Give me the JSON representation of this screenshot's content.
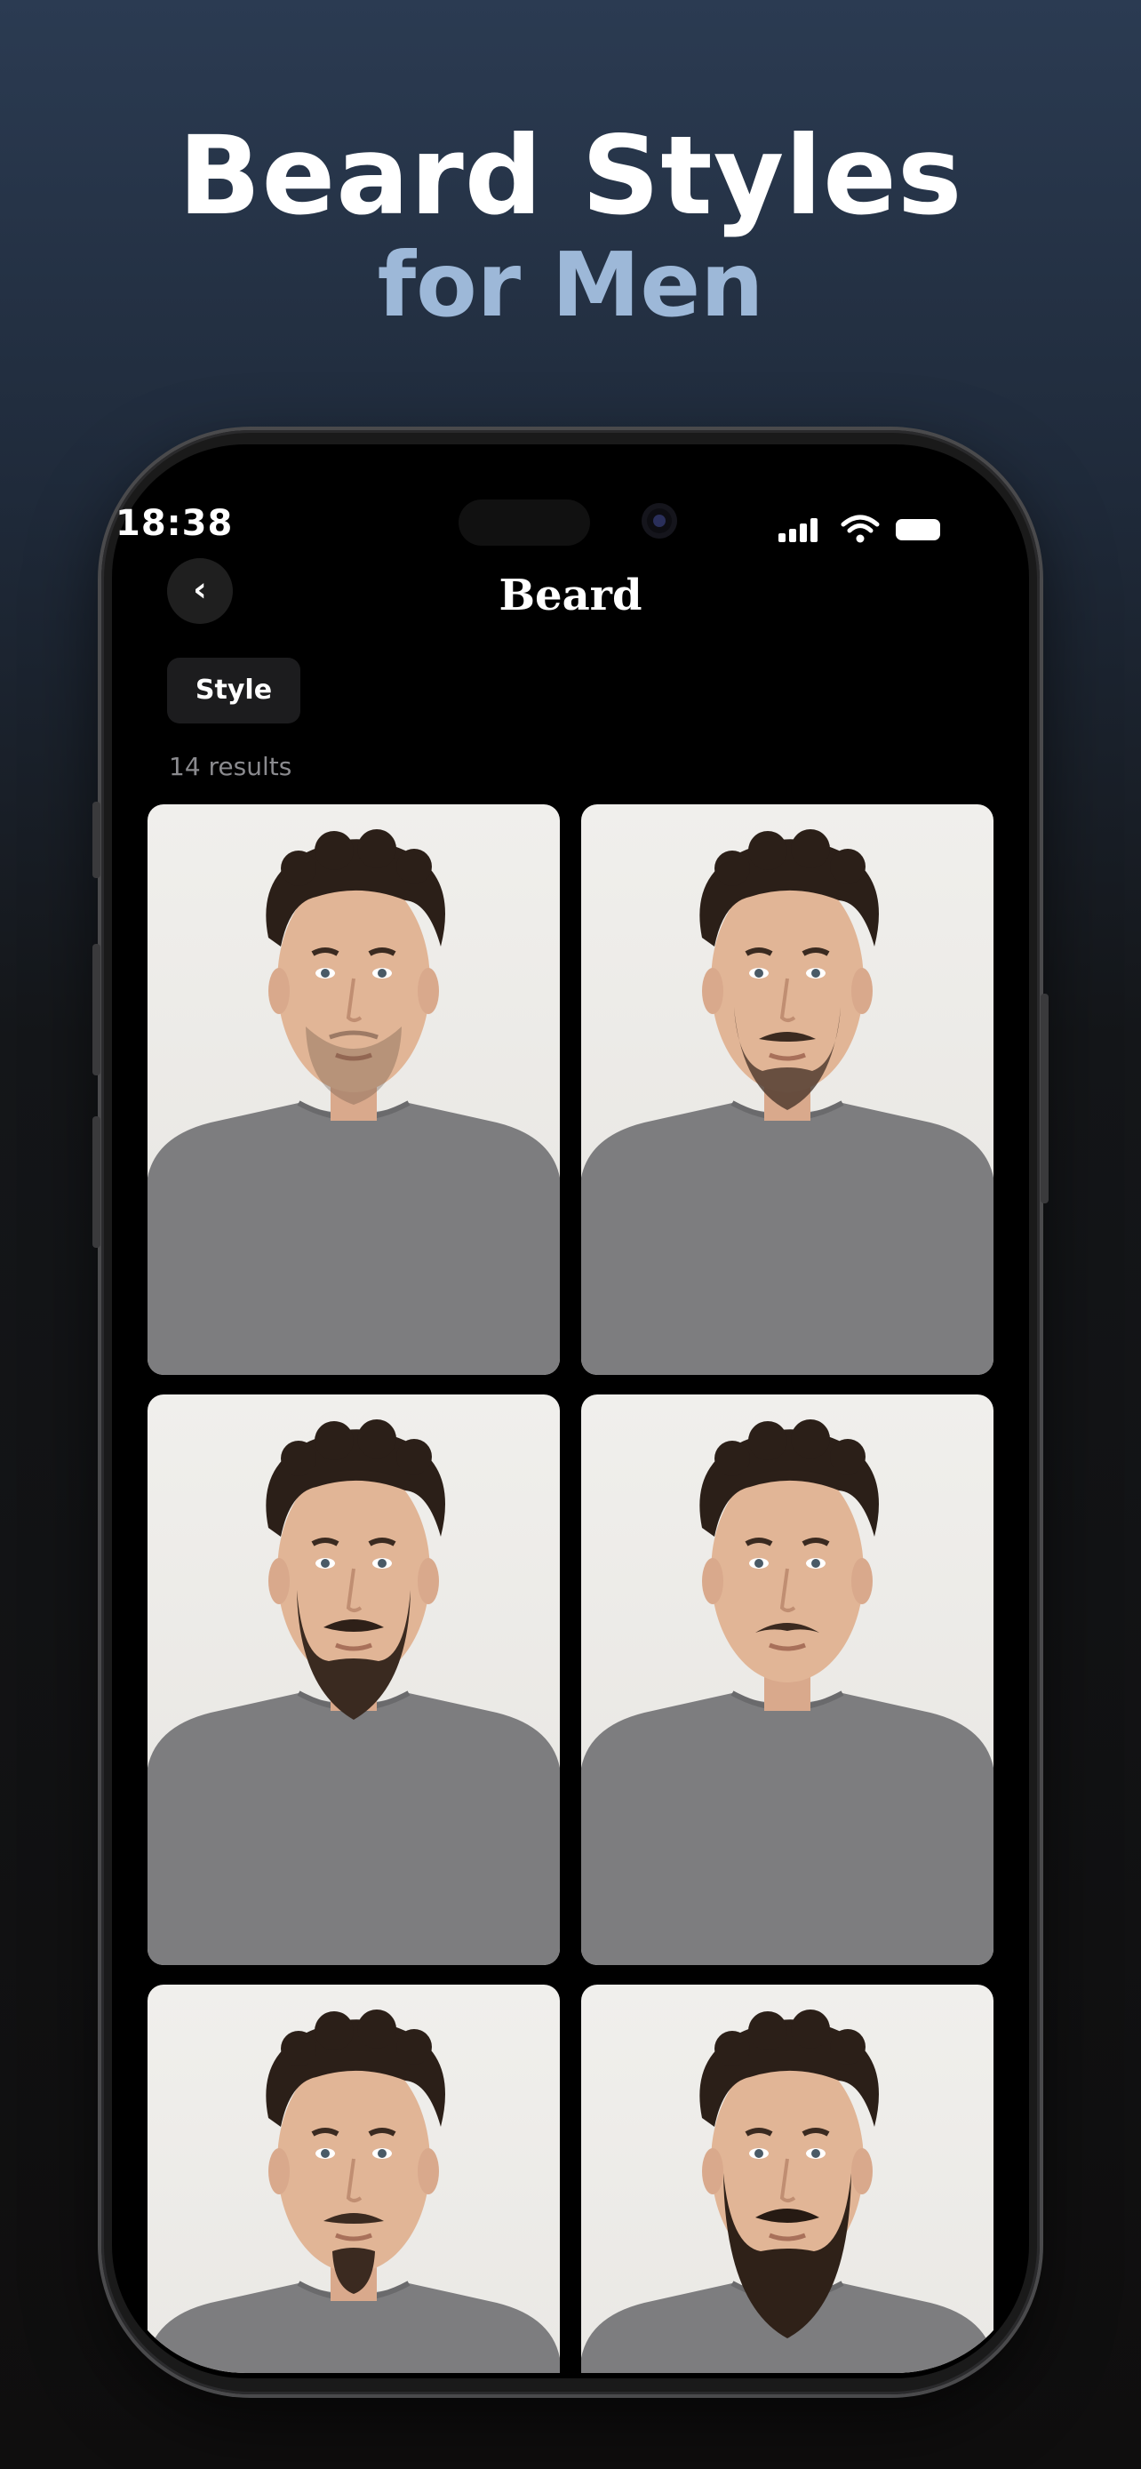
{
  "promo": {
    "title_line1": "Beard Styles",
    "title_line2": "for Men"
  },
  "status_bar": {
    "time": "18:38"
  },
  "header": {
    "back_icon": "chevron-left-icon",
    "back_glyph": "‹",
    "title": "Beard"
  },
  "filter": {
    "chip_label": "Style"
  },
  "results": {
    "count_text": "14 results"
  },
  "styles": [
    {
      "beard": "light-stubble"
    },
    {
      "beard": "short-boxed"
    },
    {
      "beard": "full-beard"
    },
    {
      "beard": "chevron-mustache"
    },
    {
      "beard": "goatee-mustache"
    },
    {
      "beard": "long-full-beard"
    }
  ],
  "colors": {
    "title_primary": "#ffffff",
    "title_accent": "#9db8d8",
    "screen_bg": "#000000",
    "chip_bg": "#1c1c1e",
    "muted_text": "#8a8a8e"
  }
}
